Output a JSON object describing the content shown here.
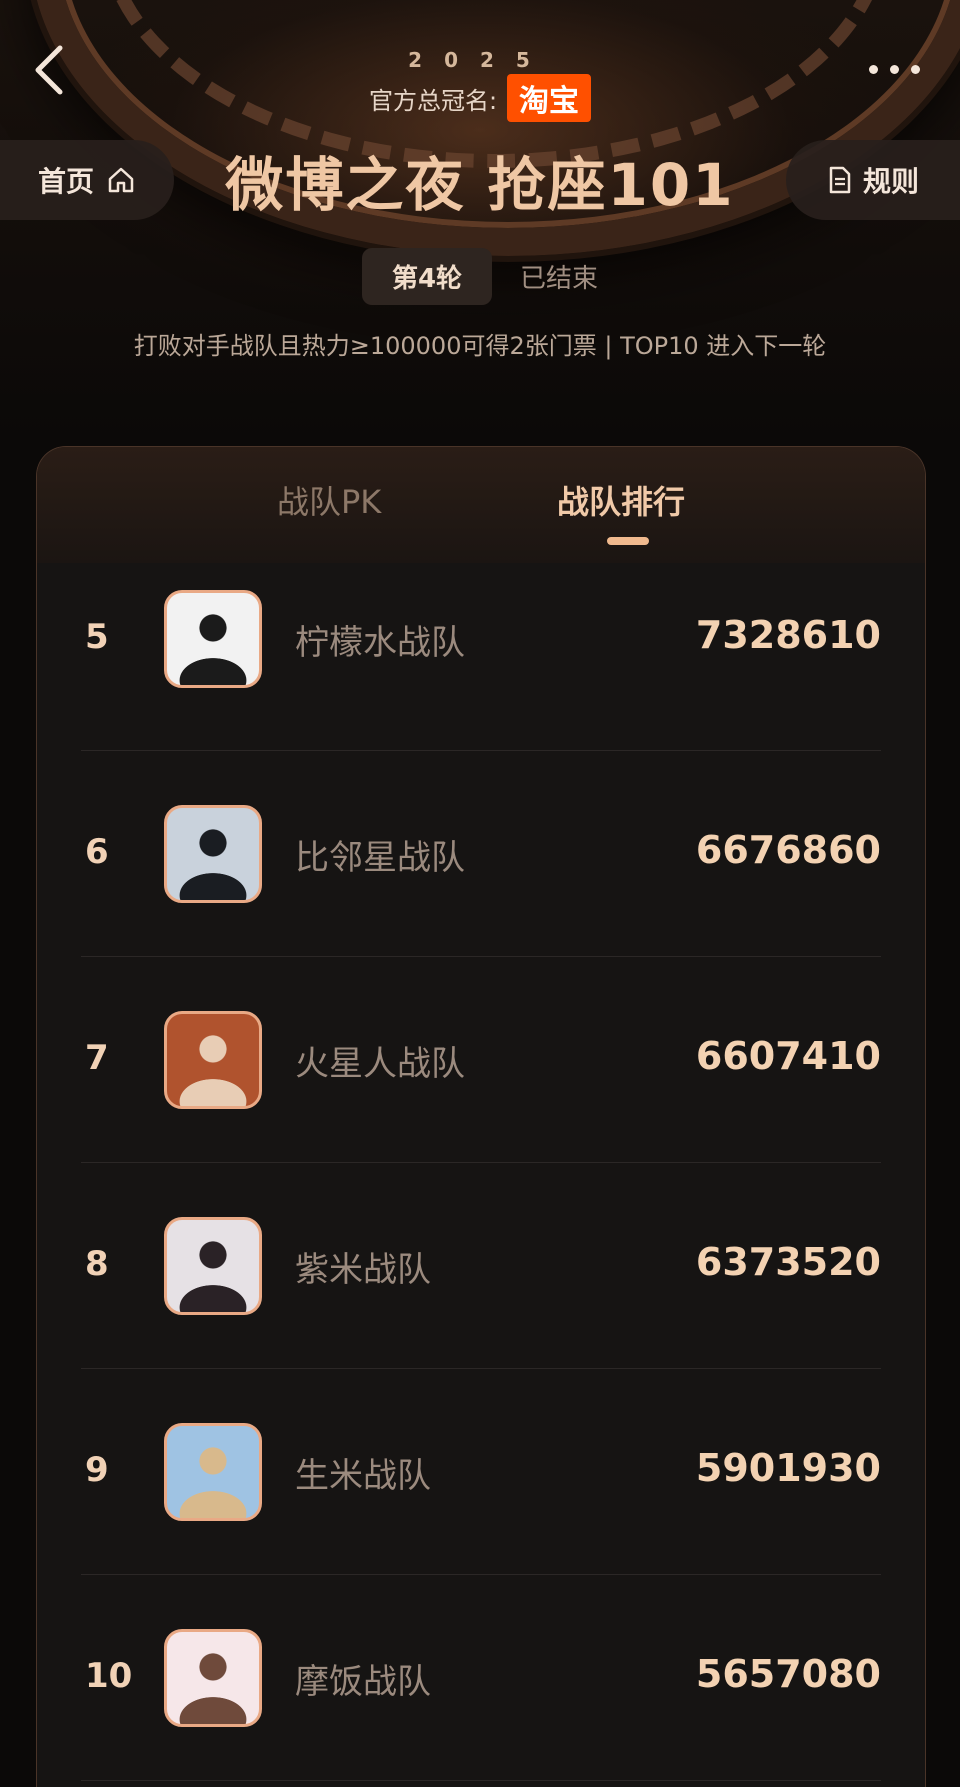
{
  "header": {
    "year": "2025",
    "sponsor_label": "官方总冠名:",
    "sponsor_logo": "淘宝",
    "home_label": "首页",
    "rules_label": "规则",
    "title": "微博之夜 抢座101",
    "round_label": "第4轮",
    "round_status": "已结束",
    "rule_text": "打败对手战队且热力≥100000可得2张门票 | TOP10 进入下一轮"
  },
  "tabs": [
    {
      "label": "战队PK",
      "active": false
    },
    {
      "label": "战队排行",
      "active": true
    }
  ],
  "ranking": [
    {
      "rank": "5",
      "team": "柠檬水战队",
      "score": "7328610",
      "avatar_colors": [
        "#f2f2f2",
        "#1b1b1b"
      ]
    },
    {
      "rank": "6",
      "team": "比邻星战队",
      "score": "6676860",
      "avatar_colors": [
        "#c9d2dc",
        "#1a1d22"
      ]
    },
    {
      "rank": "7",
      "team": "火星人战队",
      "score": "6607410",
      "avatar_colors": [
        "#b0532e",
        "#e8cdb5"
      ]
    },
    {
      "rank": "8",
      "team": "紫米战队",
      "score": "6373520",
      "avatar_colors": [
        "#e6e1e5",
        "#2a2226"
      ]
    },
    {
      "rank": "9",
      "team": "生米战队",
      "score": "5901930",
      "avatar_colors": [
        "#9fc3e3",
        "#d8b98c"
      ]
    },
    {
      "rank": "10",
      "team": "摩饭战队",
      "score": "5657080",
      "avatar_colors": [
        "#f6e7e9",
        "#6f4a3b"
      ]
    }
  ],
  "colors": {
    "accent": "#f0b98e",
    "sponsor": "#ff5000",
    "score": "#f3d2b2"
  }
}
